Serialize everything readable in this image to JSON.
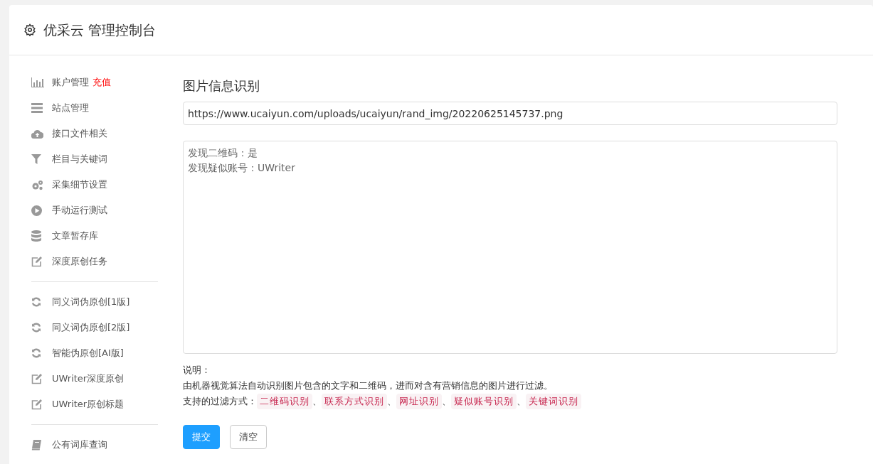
{
  "header": {
    "title": "优采云 管理控制台"
  },
  "sidebar": {
    "groups": [
      {
        "items": [
          {
            "label": "账户管理",
            "badge": "充值"
          },
          {
            "label": "站点管理"
          },
          {
            "label": "接口文件相关"
          },
          {
            "label": "栏目与关键词"
          },
          {
            "label": "采集细节设置"
          },
          {
            "label": "手动运行测试"
          },
          {
            "label": "文章暂存库"
          },
          {
            "label": "深度原创任务"
          }
        ]
      },
      {
        "items": [
          {
            "label": "同义词伪原创[1版]"
          },
          {
            "label": "同义词伪原创[2版]"
          },
          {
            "label": "智能伪原创[AI版]"
          },
          {
            "label": "UWriter深度原创"
          },
          {
            "label": "UWriter原创标题"
          }
        ]
      },
      {
        "items": [
          {
            "label": "公有词库查询"
          }
        ]
      }
    ]
  },
  "main": {
    "title": "图片信息识别",
    "url_field": {
      "value": "https://www.ucaiyun.com/uploads/ucaiyun/rand_img/20220625145737.png"
    },
    "result_field": {
      "lines": [
        "发现二维码：是",
        "发现疑似账号：UWriter"
      ]
    },
    "note_label": "说明：",
    "note_text": "由机器视觉算法自动识别图片包含的文字和二维码，进而对含有营销信息的图片进行过滤。",
    "filters_label": "支持的过滤方式：",
    "filters": [
      "二维码识别",
      "联系方式识别",
      "网址识别",
      "疑似账号识别",
      "关键词识别"
    ],
    "separator": "、",
    "buttons": [
      {
        "label": "提交",
        "kind": "primary"
      },
      {
        "label": "清空",
        "kind": "default"
      }
    ]
  }
}
